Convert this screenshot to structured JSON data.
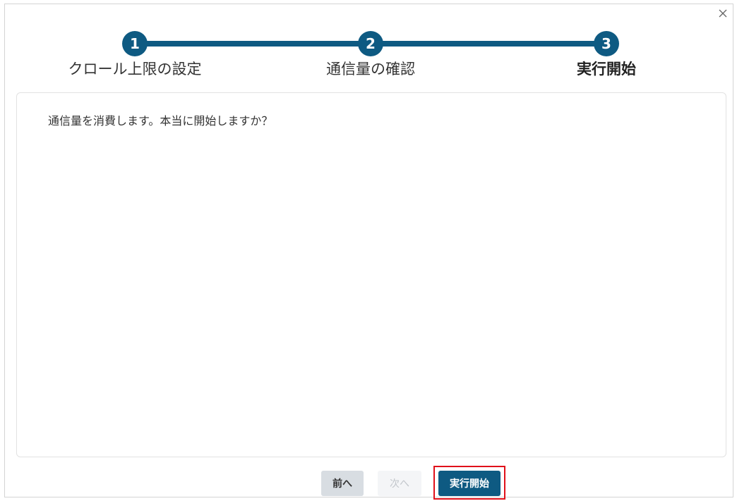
{
  "dialog": {
    "close_label": "×"
  },
  "stepper": {
    "steps": [
      {
        "number": "1",
        "label": "クロール上限の設定",
        "active": false
      },
      {
        "number": "2",
        "label": "通信量の確認",
        "active": false
      },
      {
        "number": "3",
        "label": "実行開始",
        "active": true
      }
    ]
  },
  "panel": {
    "message": "通信量を消費します。本当に開始しますか？"
  },
  "footer": {
    "prev_label": "前へ",
    "next_label": "次へ",
    "start_label": "実行開始"
  },
  "colors": {
    "primary": "#0e5a82",
    "highlight": "#e0101a",
    "disabled_bg": "#f4f5f7",
    "secondary_bg": "#d8dde2"
  },
  "icons": {
    "close": "close-icon"
  }
}
